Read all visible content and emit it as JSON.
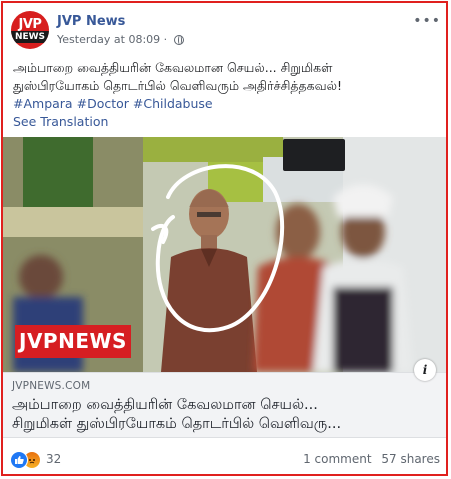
{
  "post": {
    "page_name": "JVP News",
    "avatar_top": "JVP",
    "avatar_bottom": "NEWS",
    "timestamp": "Yesterday at 08:09 · ",
    "more": "•••",
    "text_line1": "அம்பாறை வைத்தியரின் கேவலமான செயல்... சிறுமிகள்",
    "text_line2": "துஸ்பிரயோகம் தொடர்பில் வெளிவரும் அதிர்ச்சித்தகவல்!",
    "hashtags": [
      "#Ampara",
      "#Doctor",
      "#Childabuse"
    ],
    "see_translation": "See Translation"
  },
  "media": {
    "watermark": "JVPNEWS"
  },
  "link_card": {
    "domain": "JVPNEWS.COM",
    "title_line1": "அம்பாறை வைத்தியரின் கேவலமான செயல்...",
    "title_line2": "சிறுமிகள் துஸ்பிரயோகம் தொடர்பில் வெளிவரு...",
    "info": "i"
  },
  "footer": {
    "reaction_count": "32",
    "comments": "1 comment",
    "shares": "57 shares"
  },
  "colors": {
    "frame": "#e0201e",
    "link_blue": "#385898",
    "like_blue": "#2078f4"
  }
}
